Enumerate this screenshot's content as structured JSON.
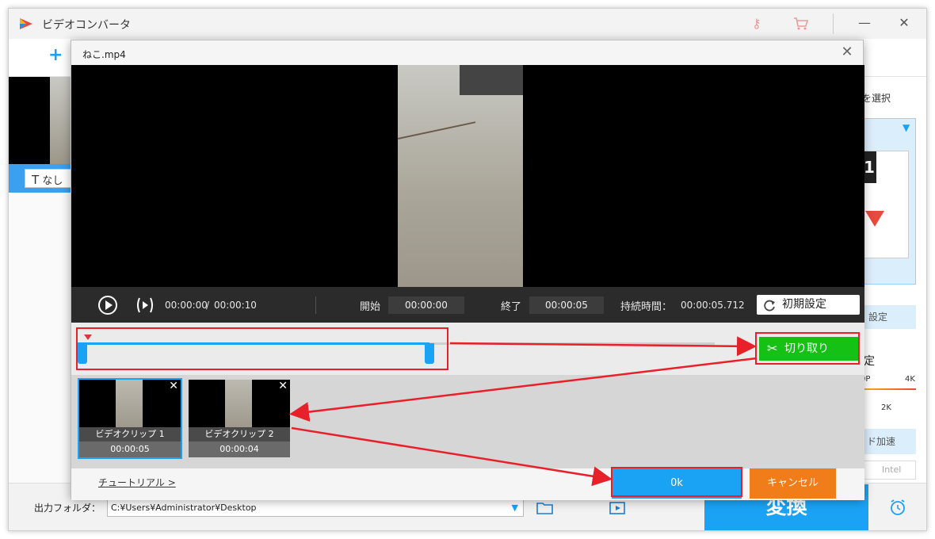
{
  "app": {
    "title": "ビデオコンバータ",
    "add_label": "+",
    "subtitle_value": "なし",
    "right_panel": {
      "format_label": "を選択",
      "settings_label": "設定",
      "quality_label": "定",
      "q_low": "0P",
      "q_mid": "2K",
      "q_high": "4K",
      "accel_label": "ド加速",
      "intel_label": "Intel"
    },
    "output_label": "出力フォルダ：",
    "output_path": "C:¥Users¥Administrator¥Desktop",
    "convert_label": "変換"
  },
  "dialog": {
    "title": "ねこ.mp4",
    "current_time": "00:00:00",
    "total_time": "00:00:10",
    "time_sep": "/",
    "start_label": "開始",
    "start_value": "00:00:00",
    "end_label": "終了",
    "end_value": "00:00:05",
    "duration_label": "持続時間：",
    "duration_value": "00:00:05.712",
    "reset_label": "初期設定",
    "cut_label": "切り取り",
    "clips": [
      {
        "label": "ビデオクリップ 1",
        "duration": "00:00:05"
      },
      {
        "label": "ビデオクリップ 2",
        "duration": "00:00:04"
      }
    ],
    "tutorial_label": "チュートリアル >",
    "ok_label": "0k",
    "cancel_label": "キャンセル"
  },
  "colors": {
    "accent": "#1aa3f5",
    "cut_green": "#16c116",
    "cancel_orange": "#f07c1a",
    "annotation_red": "#e8202a"
  }
}
